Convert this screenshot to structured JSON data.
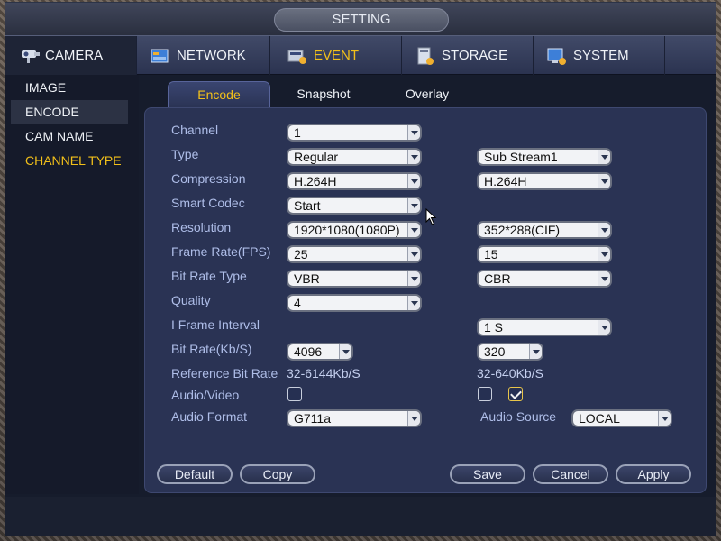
{
  "window": {
    "title": "SETTING"
  },
  "nav": {
    "tabs": [
      {
        "label": "CAMERA",
        "icon": "camera-icon",
        "active": true
      },
      {
        "label": "NETWORK",
        "icon": "network-icon"
      },
      {
        "label": "EVENT",
        "icon": "event-icon"
      },
      {
        "label": "STORAGE",
        "icon": "storage-icon"
      },
      {
        "label": "SYSTEM",
        "icon": "system-icon"
      }
    ]
  },
  "sidebar": {
    "items": [
      {
        "label": "IMAGE"
      },
      {
        "label": "ENCODE",
        "active": true
      },
      {
        "label": "CAM NAME"
      },
      {
        "label": "CHANNEL TYPE"
      }
    ]
  },
  "subtabs": [
    {
      "label": "Encode",
      "active": true
    },
    {
      "label": "Snapshot"
    },
    {
      "label": "Overlay"
    }
  ],
  "form": {
    "channel": {
      "label": "Channel",
      "value": "1"
    },
    "type": {
      "label": "Type",
      "main": "Regular",
      "sub": "Sub Stream1"
    },
    "compression": {
      "label": "Compression",
      "main": "H.264H",
      "sub": "H.264H"
    },
    "smart_codec": {
      "label": "Smart Codec",
      "value": "Start"
    },
    "resolution": {
      "label": "Resolution",
      "main": "1920*1080(1080P)",
      "sub": "352*288(CIF)"
    },
    "frame_rate": {
      "label": "Frame Rate(FPS)",
      "main": "25",
      "sub": "15"
    },
    "bit_rate_type": {
      "label": "Bit Rate Type",
      "main": "VBR",
      "sub": "CBR"
    },
    "quality": {
      "label": "Quality",
      "value": "4"
    },
    "i_frame": {
      "label": "I Frame Interval",
      "sub": "1 S"
    },
    "bit_rate": {
      "label": "Bit Rate(Kb/S)",
      "main": "4096",
      "sub": "320"
    },
    "ref_bit_rate": {
      "label": "Reference Bit Rate",
      "main": "32-6144Kb/S",
      "sub": "32-640Kb/S"
    },
    "audio_video": {
      "label": "Audio/Video",
      "main_checked": false,
      "sub_checked": false,
      "sub2_checked": true
    },
    "audio_format": {
      "label": "Audio Format",
      "value": "G711a"
    },
    "audio_source": {
      "label": "Audio Source",
      "value": "LOCAL"
    }
  },
  "buttons": {
    "default": "Default",
    "copy": "Copy",
    "save": "Save",
    "cancel": "Cancel",
    "apply": "Apply"
  },
  "colors": {
    "accent": "#f2c01a",
    "label": "#aebde8",
    "panel": "#2a3354"
  }
}
